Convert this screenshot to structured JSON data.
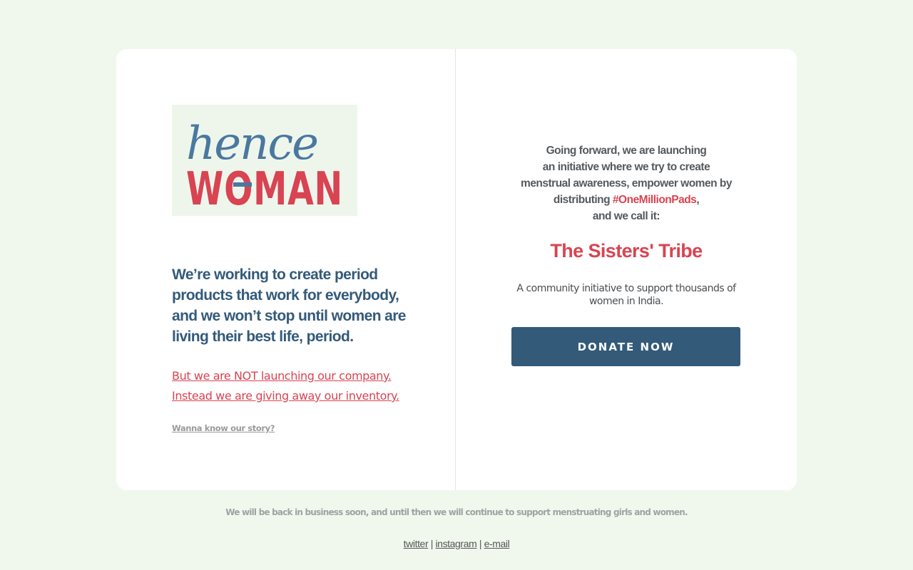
{
  "logo": {
    "line1": "hence",
    "line2": "WOMAN",
    "colors": {
      "blue": "#4a78a0",
      "red": "#d84452",
      "bg": "#eef6ec"
    }
  },
  "left": {
    "tagline": "We’re working to create period products that work for everybody, and we won’t stop until women are living their best life, period.",
    "red_link_1": "But we are NOT launching our company.",
    "red_link_2": "Instead we are giving away our inventory.",
    "story_link": "Wanna know our story?"
  },
  "right": {
    "intro_lines": [
      "Going forward, we are launching",
      "an initiative where we try to create",
      "menstrual awareness, empower women by"
    ],
    "intro_distributing": "distributing ",
    "hashtag": "#OneMillionPads",
    "intro_comma": ",",
    "intro_last": "and we call it:",
    "title": "The Sisters' Tribe",
    "description": "A community initiative to support thousands of women in India.",
    "donate_label": "DONATE NOW"
  },
  "footer": {
    "note": "We will be back in business soon, and until then we will continue to support menstruating girls and women.",
    "links": [
      "twitter",
      "instagram",
      "e-mail"
    ],
    "separator": "|"
  },
  "colors": {
    "page_bg": "#f0f8ee",
    "brand_blue": "#335a79",
    "brand_red": "#d84452"
  }
}
